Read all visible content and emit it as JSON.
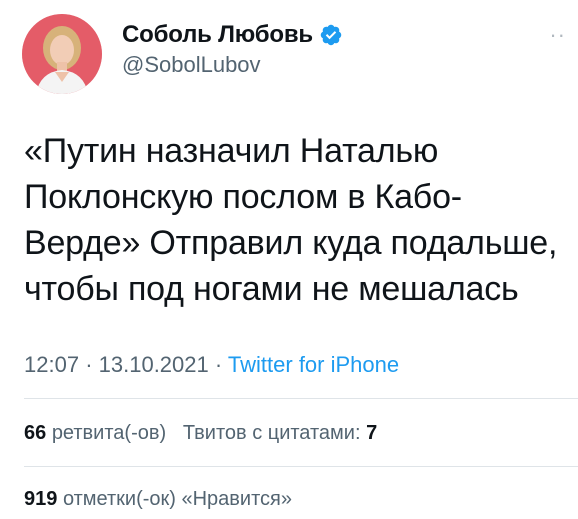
{
  "author": {
    "display_name": "Соболь Любовь",
    "username": "@SobolLubov",
    "verified": true,
    "verified_icon": "verified-badge-icon",
    "avatar_background": "#e8303f"
  },
  "more_icon": "more-options-icon",
  "tweet": {
    "text": "«Путин назначил Наталью\nПоклонскую послом в Кабо-\nВерде» Отправил куда подальше,\nчтобы под ногами не мешалась",
    "time": "12:07",
    "separator": "·",
    "date": "13.10.2021",
    "source": "Twitter for iPhone"
  },
  "stats": {
    "retweets_count": "66",
    "retweets_label": "ретвита(-ов)",
    "quotes_label": "Твитов с цитатами:",
    "quotes_count": "7",
    "likes_count": "919",
    "likes_label": "отметки(-ок) «Нравится»"
  },
  "colors": {
    "link": "#1d9bf0",
    "secondary_text": "#536471",
    "primary_text": "#0f1419"
  }
}
